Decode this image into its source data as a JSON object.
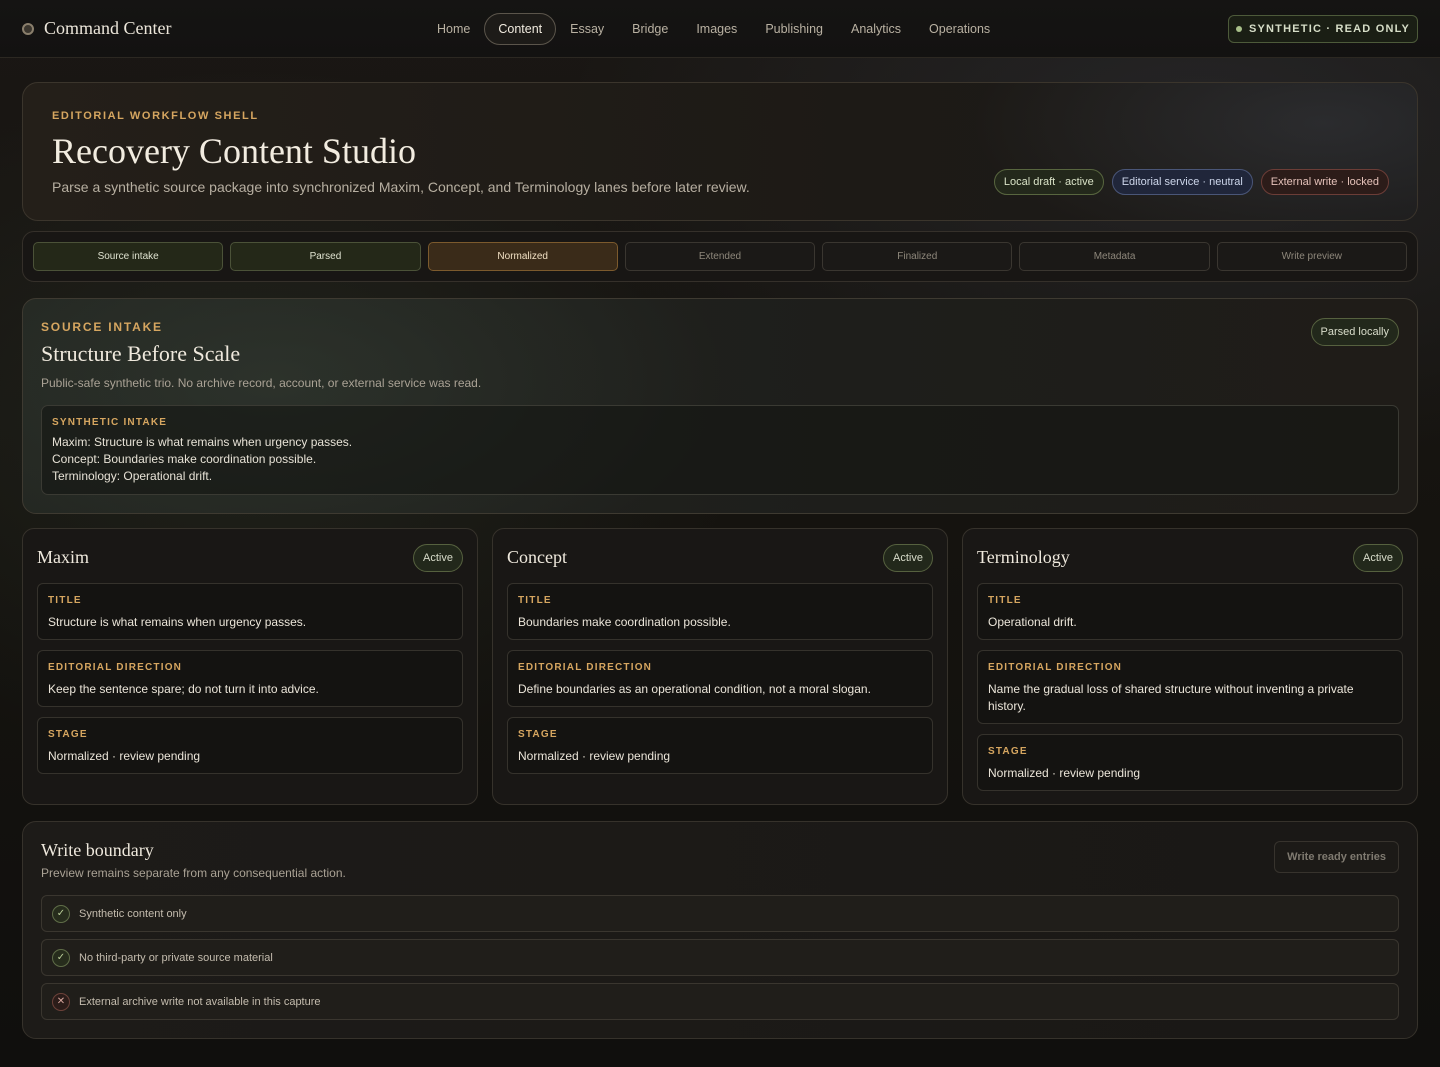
{
  "app": {
    "title": "Command Center"
  },
  "nav": {
    "items": [
      {
        "label": "Home",
        "active": false
      },
      {
        "label": "Content",
        "active": true
      },
      {
        "label": "Essay",
        "active": false
      },
      {
        "label": "Bridge",
        "active": false
      },
      {
        "label": "Images",
        "active": false
      },
      {
        "label": "Publishing",
        "active": false
      },
      {
        "label": "Analytics",
        "active": false
      },
      {
        "label": "Operations",
        "active": false
      }
    ],
    "status_badge": "SYNTHETIC · READ ONLY"
  },
  "hero": {
    "eyebrow": "EDITORIAL WORKFLOW SHELL",
    "title": "Recovery Content Studio",
    "subtitle": "Parse a synthetic source package into synchronized Maxim, Concept, and Terminology lanes before later review.",
    "chips": [
      {
        "label": "Local draft · active",
        "tone": "green"
      },
      {
        "label": "Editorial service · neutral",
        "tone": "blue"
      },
      {
        "label": "External write · locked",
        "tone": "red"
      }
    ]
  },
  "stepper": {
    "steps": [
      {
        "label": "Source intake",
        "state": "done"
      },
      {
        "label": "Parsed",
        "state": "done"
      },
      {
        "label": "Normalized",
        "state": "current"
      },
      {
        "label": "Extended",
        "state": "pending"
      },
      {
        "label": "Finalized",
        "state": "pending"
      },
      {
        "label": "Metadata",
        "state": "pending"
      },
      {
        "label": "Write preview",
        "state": "pending"
      }
    ]
  },
  "intake": {
    "eyebrow": "SOURCE INTAKE",
    "title": "Structure Before Scale",
    "subtitle": "Public-safe synthetic trio. No archive record, account, or external service was read.",
    "status": "Parsed locally",
    "box_label": "SYNTHETIC INTAKE",
    "lines": [
      "Maxim: Structure is what remains when urgency passes.",
      "Concept: Boundaries make coordination possible.",
      "Terminology: Operational drift."
    ]
  },
  "lanes": [
    {
      "title": "Maxim",
      "status": "Active",
      "fields": [
        {
          "label": "TITLE",
          "value": "Structure is what remains when urgency passes."
        },
        {
          "label": "EDITORIAL DIRECTION",
          "value": "Keep the sentence spare; do not turn it into advice."
        },
        {
          "label": "STAGE",
          "value": "Normalized · review pending"
        }
      ]
    },
    {
      "title": "Concept",
      "status": "Active",
      "fields": [
        {
          "label": "TITLE",
          "value": "Boundaries make coordination possible."
        },
        {
          "label": "EDITORIAL DIRECTION",
          "value": "Define boundaries as an operational condition, not a moral slogan."
        },
        {
          "label": "STAGE",
          "value": "Normalized · review pending"
        }
      ]
    },
    {
      "title": "Terminology",
      "status": "Active",
      "fields": [
        {
          "label": "TITLE",
          "value": "Operational drift."
        },
        {
          "label": "EDITORIAL DIRECTION",
          "value": "Name the gradual loss of shared structure without inventing a private history."
        },
        {
          "label": "STAGE",
          "value": "Normalized · review pending"
        }
      ]
    }
  ],
  "boundary": {
    "title": "Write boundary",
    "subtitle": "Preview remains separate from any consequential action.",
    "button": "Write ready entries",
    "checks": [
      {
        "label": "Synthetic content only",
        "ok": true
      },
      {
        "label": "No third-party or private source material",
        "ok": true
      },
      {
        "label": "External archive write not available in this capture",
        "ok": false
      }
    ]
  },
  "icons": {
    "ok": "check-icon",
    "blocked": "x-icon"
  }
}
